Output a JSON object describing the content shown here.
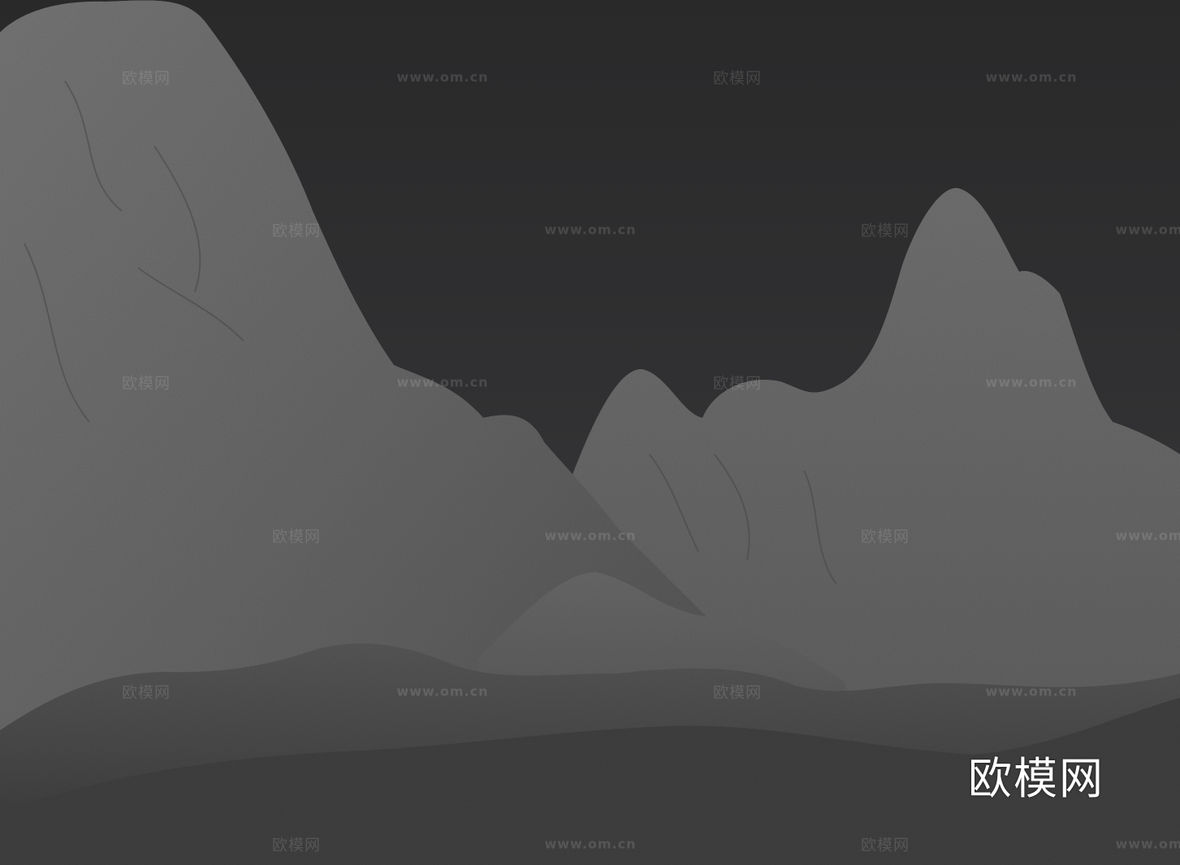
{
  "watermark": {
    "url_text": "www.om.cn",
    "brand_text": "欧模网"
  },
  "logo": {
    "text": "欧模网"
  },
  "colors": {
    "sky": "#2d2d2e",
    "rock": "#6a6a6a",
    "ground": "#4a4a4a"
  }
}
